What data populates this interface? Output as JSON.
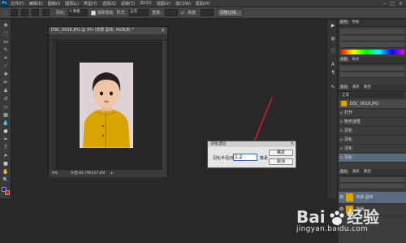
{
  "menubar": {
    "logo": "Ps",
    "items": [
      "文件(F)",
      "编辑(E)",
      "图像(I)",
      "图层(L)",
      "类型(Y)",
      "选择(S)",
      "滤镜(T)",
      "3D(D)",
      "视图(V)",
      "窗口(W)",
      "帮助(H)"
    ],
    "win_controls": [
      "–",
      "□",
      "×"
    ]
  },
  "options_bar": {
    "feather_label": "羽化:",
    "feather_value": "0 像素",
    "antialias_label": "消除锯齿",
    "style_label": "样式:",
    "style_value": "正常",
    "width_label": "宽度:",
    "height_label": "高度:",
    "refine_button": "调整边缘..."
  },
  "document": {
    "tab_title": "DSC_0016.JPG @ 9% (背景 副本, RGB/8) *",
    "status_zoom": "9%",
    "status_doc": "文档:60.7M/137.0M"
  },
  "dialog": {
    "title": "羽化选区",
    "field_label": "羽化半径(R):",
    "field_value": "1.2",
    "unit": "像素",
    "ok_label": "确定",
    "cancel_label": "取消"
  },
  "panels": {
    "top_tabs": [
      "颜色",
      "色板"
    ],
    "mid_tabs": [
      "调整",
      "样式"
    ],
    "layers_tabs": [
      "图层",
      "通道",
      "路径"
    ],
    "layers_mode": "正常",
    "layers": [
      {
        "name": "DSC_0016.JPG",
        "thumb_color": "#d9a400"
      },
      {
        "name": "打开"
      },
      {
        "name": "矩形选框"
      },
      {
        "name": "羽化"
      },
      {
        "name": "羽化"
      },
      {
        "name": "羽化"
      },
      {
        "name": "羽化"
      }
    ],
    "bottom_tabs": [
      "图层",
      "通道",
      "路径"
    ],
    "bottom_layers": [
      {
        "name": "背景 副本"
      },
      {
        "name": "背景"
      }
    ]
  },
  "watermark": {
    "text": "jingyan.baidu.com"
  },
  "colors": {
    "accent_arrow": "#e01b1b",
    "photo_jacket": "#d9a400",
    "input_border": "#2a6cc7"
  }
}
